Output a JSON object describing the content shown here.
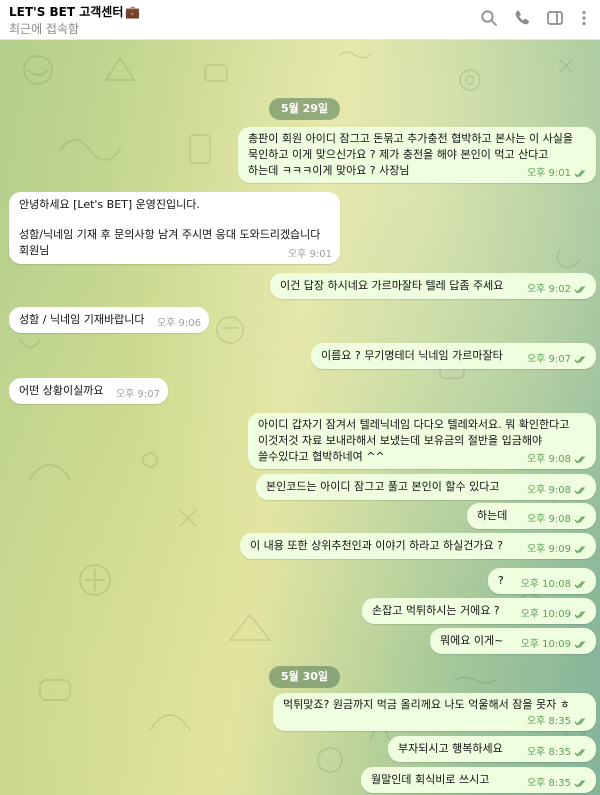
{
  "header": {
    "title": "LET'S BET 고객센터",
    "title_emoji": "💼",
    "status": "최근에 접속함",
    "icons": [
      "search-icon",
      "phone-icon",
      "sidebar-icon",
      "more-icon"
    ]
  },
  "colors": {
    "outgoing_bubble": "#eefedf",
    "incoming_bubble": "#ffffff",
    "outgoing_time": "#5ea05b",
    "incoming_time": "#a0a0a0",
    "date_pill": "#5f825f"
  },
  "dates": [
    "5월 29일",
    "5월 30일"
  ],
  "messages": [
    {
      "dir": "out",
      "lines": [
        "총판이 회원 아이디 잠그고 돈묶고 추가충전 협박하고 본사는 이 사실을",
        "묵인하고 이게 맞으신가요 ? 제가 충전을 해야 본인이 먹고 산다고",
        "하는데 ㅋㅋㅋ이게 맞아요 ? 사장님"
      ],
      "time": "오후 9:01"
    },
    {
      "dir": "in",
      "lines": [
        "안녕하세요  [Let's BET] 운영진입니다.",
        "",
        "성함/닉네임 기재 후 문의사항 남겨 주시면 응대 도와드리겠습니다",
        "회원님"
      ],
      "time": "오후 9:01"
    },
    {
      "dir": "out",
      "lines": [
        "이건 답장 하시네요 가르마잘타 텔레 답좀 주세요"
      ],
      "time": "오후 9:02"
    },
    {
      "dir": "in",
      "lines": [
        "성함 / 닉네임 기재바랍니다"
      ],
      "time": "오후 9:06"
    },
    {
      "dir": "out",
      "lines": [
        "이름요 ? 무기명테더 닉네임 가르마잘타"
      ],
      "time": "오후 9:07"
    },
    {
      "dir": "in",
      "lines": [
        "어떤 상황이실까요"
      ],
      "time": "오후 9:07"
    },
    {
      "dir": "out",
      "lines": [
        "아이디 갑자기 잠겨서  텔레닉네임 다다오 텔레와서요. 뭐 확인한다고",
        "이것저것 자료 보내라해서 보냈는데  보유금의 절반을 입금해야",
        "쓸수있다고 협박하네여 ^^"
      ],
      "time": "오후 9:08"
    },
    {
      "dir": "out",
      "lines": [
        "본인코드는 아이디 잠그고 풀고 본인이 할수 있다고"
      ],
      "time": "오후 9:08"
    },
    {
      "dir": "out",
      "lines": [
        "하는데"
      ],
      "time": "오후 9:08"
    },
    {
      "dir": "out",
      "lines": [
        "이 내용 또한 상위추천인과 이야기 하라고 하실건가요 ?"
      ],
      "time": "오후 9:09"
    },
    {
      "dir": "out",
      "lines": [
        "?"
      ],
      "time": "오후 10:08"
    },
    {
      "dir": "out",
      "lines": [
        "손잡고 먹튀하시는 거에요 ?"
      ],
      "time": "오후 10:09"
    },
    {
      "dir": "out",
      "lines": [
        "뭐에요 이게~"
      ],
      "time": "오후 10:09"
    },
    {
      "dir": "out",
      "lines": [
        "먹튀맞죠? 원금까지  먹금 올리께요 나도 억울해서 잠을 못자 ㅎ"
      ],
      "time": "오후 8:35"
    },
    {
      "dir": "out",
      "lines": [
        "부자되시고 행복하세요"
      ],
      "time": "오후 8:35"
    },
    {
      "dir": "out",
      "lines": [
        "월말인데 회식비로 쓰시고"
      ],
      "time": "오후 8:35"
    }
  ]
}
